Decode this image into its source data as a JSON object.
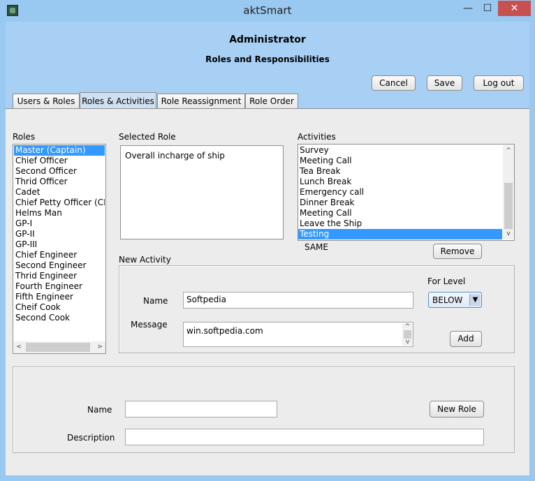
{
  "window": {
    "title": "aktSmart",
    "controls": {
      "minimize": "—",
      "maximize": "☐",
      "close": "✕"
    }
  },
  "header": {
    "title": "Administrator",
    "subtitle": "Roles and Responsibilities",
    "cancel_label": "Cancel",
    "save_label": "Save",
    "logout_label": "Log out"
  },
  "tabs": [
    {
      "label": "Users & Roles",
      "active": false
    },
    {
      "label": "Roles & Activities",
      "active": true
    },
    {
      "label": "Role Reassignment",
      "active": false
    },
    {
      "label": "Role Order",
      "active": false
    }
  ],
  "roles": {
    "label": "Roles",
    "items": [
      "Master (Captain)",
      "Chief Officer",
      "Second Officer",
      "Thrid Officer",
      "Cadet",
      "Chief Petty Officer (CPO",
      "Helms Man",
      "GP-I",
      "GP-II",
      "GP-III",
      "Chief Engineer",
      "Second Engineer",
      "Thrid Engineer",
      "Fourth Engineer",
      "Fifth Engineer",
      "Cheif Cook",
      "Second Cook"
    ],
    "selected_index": 0
  },
  "selected_role": {
    "label": "Selected Role",
    "text": "Overall incharge of ship"
  },
  "activities": {
    "label": "Activities",
    "items": [
      "Survey",
      "Meeting Call",
      "Tea Break",
      "Lunch Break",
      "Emergency call",
      "Dinner Break",
      "Meeting Call",
      "Leave the Ship",
      "Testing"
    ],
    "selected_index": 8,
    "level_text": "SAME",
    "remove_label": "Remove"
  },
  "new_activity": {
    "label": "New Activity",
    "name_label": "Name",
    "name_value": "Softpedia",
    "message_label": "Message",
    "message_value": "win.softpedia.com",
    "for_level_label": "For Level",
    "level_value": "BELOW",
    "add_label": "Add"
  },
  "new_role": {
    "name_label": "Name",
    "name_value": "",
    "description_label": "Description",
    "description_value": "",
    "button_label": "New Role"
  }
}
